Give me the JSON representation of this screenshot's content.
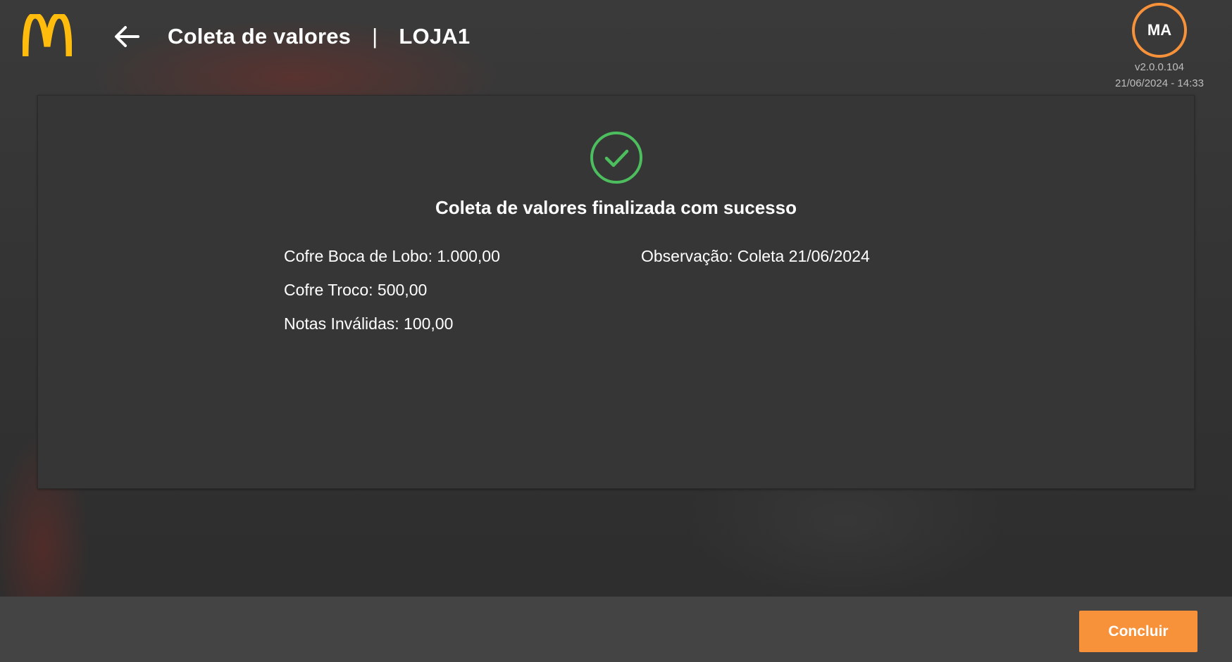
{
  "header": {
    "title": "Coleta de valores",
    "separator": "|",
    "store": "LOJA1",
    "avatar_initials": "MA",
    "version": "v2.0.0.104",
    "datetime": "21/06/2024 - 14:33",
    "logo_icon": "mcdonalds-arches-logo",
    "back_icon": "arrow-left-icon"
  },
  "result": {
    "icon": "check-circle-icon",
    "message": "Coleta de valores finalizada com sucesso",
    "cofre_boca_de_lobo": "Cofre Boca de Lobo: 1.000,00",
    "cofre_troco": "Cofre Troco: 500,00",
    "notas_invalidas": "Notas Inválidas: 100,00",
    "observacao": "Observação: Coleta 21/06/2024"
  },
  "footer": {
    "concluir_label": "Concluir"
  },
  "colors": {
    "accent_orange": "#f7923a",
    "success_green": "#4cbe5e",
    "logo_yellow": "#ffbc0d",
    "card_background": "#363636",
    "footer_background": "#444444"
  }
}
